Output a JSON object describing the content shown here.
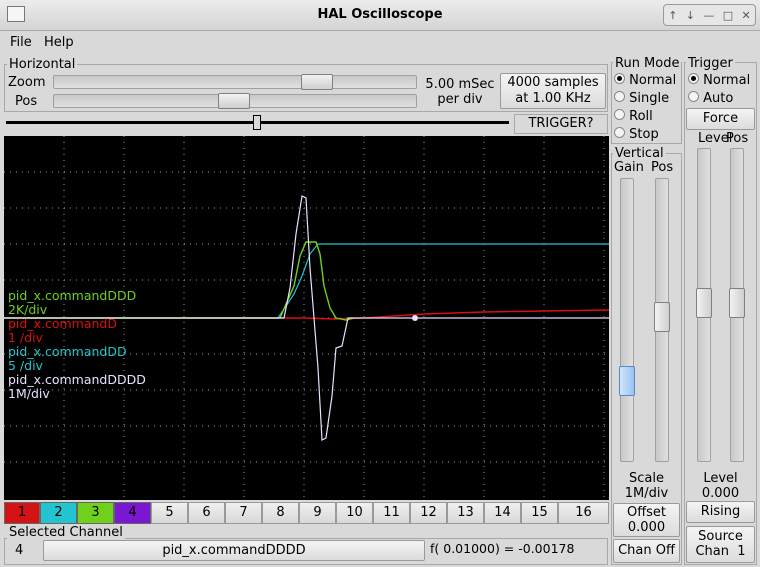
{
  "window": {
    "title": "HAL Oscilloscope"
  },
  "menu": {
    "file": "File",
    "help": "Help"
  },
  "horizontal": {
    "legend": "Horizontal",
    "zoom_label": "Zoom",
    "pos_label": "Pos",
    "per_div_value": "5.00 mSec",
    "per_div_unit": "per div",
    "samples": "4000 samples",
    "rate": "at 1.00 KHz",
    "trigger_status": "TRIGGER?"
  },
  "run_mode": {
    "legend": "Run Mode",
    "options": [
      "Normal",
      "Single",
      "Roll",
      "Stop"
    ],
    "selected": "Normal"
  },
  "trigger": {
    "legend": "Trigger",
    "options": [
      "Normal",
      "Auto"
    ],
    "selected": "Normal",
    "force_label": "Force",
    "level_header": "Level",
    "pos_header": "Pos",
    "level_label": "Level",
    "level_value": "0.000",
    "edge_button": "Rising",
    "source_label": "Source",
    "source_value": "Chan  1"
  },
  "vertical": {
    "legend": "Vertical",
    "gain_header": "Gain",
    "pos_header": "Pos",
    "scale_label": "Scale",
    "scale_value": "1M/div",
    "offset_label": "Offset",
    "offset_value": "0.000",
    "chan_off_label": "Chan Off"
  },
  "traces": [
    {
      "name": "pid_x.commandDDD",
      "scale": "2K/div",
      "color": "#6fd11b"
    },
    {
      "name": "pid_x.commandD",
      "scale": "1 /div",
      "color": "#d81010"
    },
    {
      "name": "pid_x.commandDD",
      "scale": "5 /div",
      "color": "#22c5cf"
    },
    {
      "name": "pid_x.commandDDDD",
      "scale": "1M/div",
      "color": "#e8e0ff"
    }
  ],
  "channels": {
    "tabs": [
      "1",
      "2",
      "3",
      "4",
      "5",
      "6",
      "7",
      "8",
      "9",
      "10",
      "11",
      "12",
      "13",
      "14",
      "15",
      "16"
    ],
    "active_colors": [
      "#d41414",
      "#22c5cf",
      "#6fd11b",
      "#7a17d0"
    ]
  },
  "selected_channel": {
    "legend": "Selected Channel",
    "number": "4",
    "name": "pid_x.commandDDDD",
    "readout": "f( 0.01000) = -0.00178"
  }
}
